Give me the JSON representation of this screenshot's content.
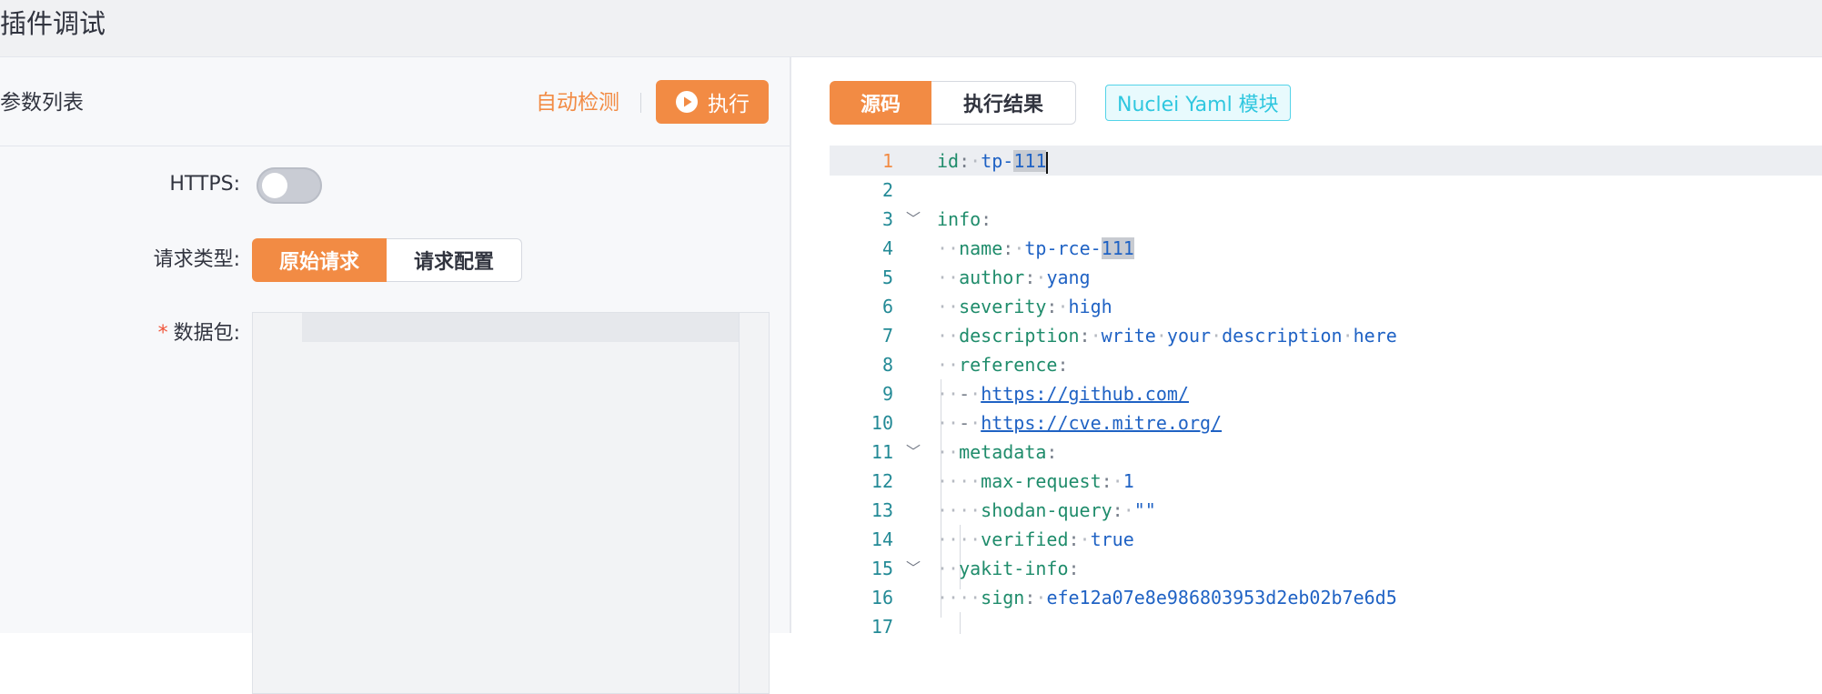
{
  "header": {
    "title": "插件调试"
  },
  "left": {
    "params_title": "参数列表",
    "auto_detect": "自动检测",
    "execute": "执行",
    "https_label": "HTTPS:",
    "https_enabled": false,
    "request_type_label": "请求类型:",
    "request_type_options": [
      "原始请求",
      "请求配置"
    ],
    "request_type_selected": "原始请求",
    "packet_required": "*",
    "packet_label": "数据包:"
  },
  "right": {
    "tabs": [
      "源码",
      "执行结果"
    ],
    "active_tab": "源码",
    "module_tag": "Nuclei Yaml 模块"
  },
  "code": {
    "current_line": 1,
    "line_numbers": [
      "1",
      "2",
      "3",
      "4",
      "5",
      "6",
      "7",
      "8",
      "9",
      "10",
      "11",
      "12",
      "13",
      "14",
      "15",
      "16",
      "17"
    ],
    "id_key": "id",
    "id_prefix": "tp-",
    "id_suffix": "111",
    "info_key": "info",
    "name_key": "name",
    "name_prefix": "tp-rce-",
    "name_suffix": "111",
    "author_key": "author",
    "author_val": "yang",
    "severity_key": "severity",
    "severity_val": "high",
    "description_key": "description",
    "description_w1": "write",
    "description_w2": "your",
    "description_w3": "description",
    "description_w4": "here",
    "reference_key": "reference",
    "dash": "-",
    "ref1": "https://github.com/",
    "ref2": "https://cve.mitre.org/",
    "metadata_key": "metadata",
    "max_request_key": "max-request",
    "max_request_val": "1",
    "shodan_key": "shodan-query",
    "shodan_val": "\"\"",
    "verified_key": "verified",
    "verified_val": "true",
    "yakit_key": "yakit-info",
    "sign_key": "sign",
    "sign_val": "efe12a07e8e986803953d2eb02b7e6d5"
  }
}
